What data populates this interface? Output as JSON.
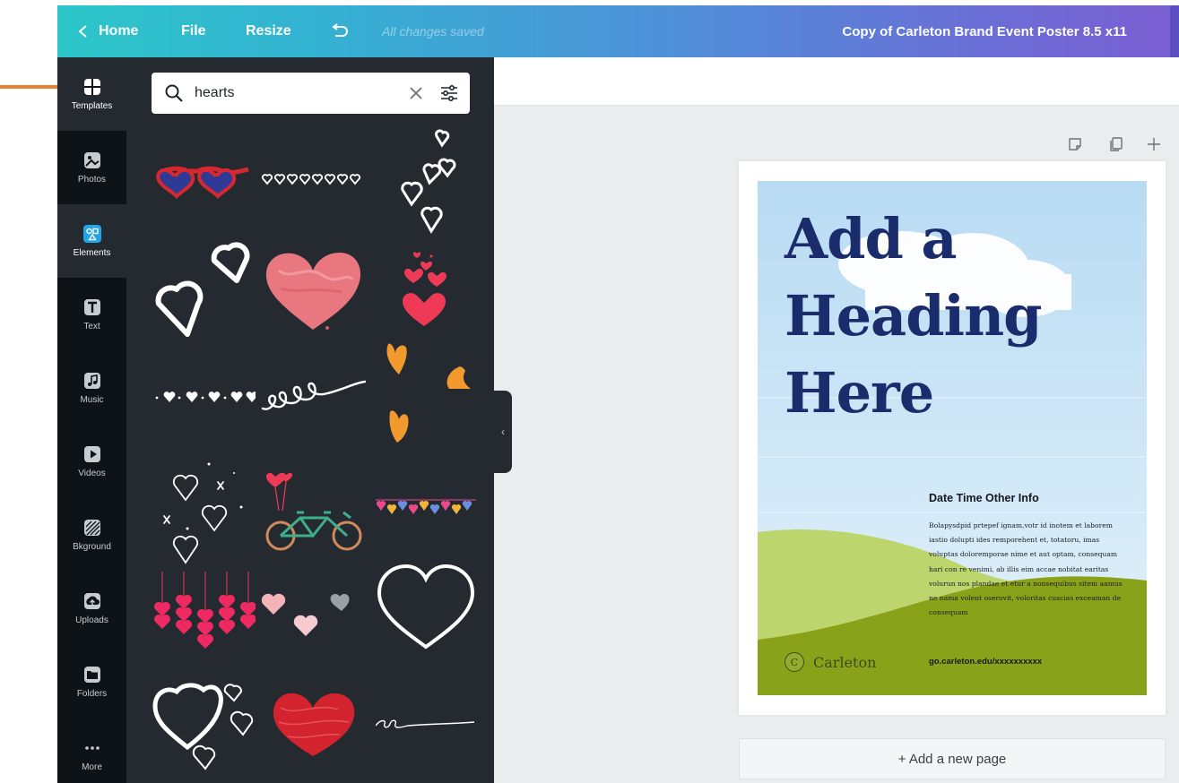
{
  "topbar": {
    "home_label": "Home",
    "file_label": "File",
    "resize_label": "Resize",
    "saved_status": "All changes saved",
    "document_title": "Copy of Carleton Brand Event Poster 8.5 x11",
    "gradient_start": "#2cc6c8",
    "gradient_end": "#7b5ed2"
  },
  "rail": {
    "items": [
      {
        "label": "Templates",
        "icon": "templates-icon"
      },
      {
        "label": "Photos",
        "icon": "photos-icon"
      },
      {
        "label": "Elements",
        "icon": "elements-icon",
        "active": true
      },
      {
        "label": "Text",
        "icon": "text-icon"
      },
      {
        "label": "Music",
        "icon": "music-icon"
      },
      {
        "label": "Videos",
        "icon": "videos-icon"
      },
      {
        "label": "Bkground",
        "icon": "background-icon"
      },
      {
        "label": "Uploads",
        "icon": "uploads-icon"
      },
      {
        "label": "Folders",
        "icon": "folders-icon"
      },
      {
        "label": "More",
        "icon": "more-icon"
      }
    ]
  },
  "search": {
    "value": "hearts"
  },
  "results": [
    "heart-sunglasses",
    "small-hearts-row",
    "scattered-outline-hearts",
    "double-outline-hearts",
    "painted-pink-heart",
    "falling-red-hearts",
    "dotted-hearts-line",
    "looped-hearts-line",
    "orange-hearts",
    "sketched-hearts-stars",
    "tandem-bike-hearts",
    "colorful-heart-bunting",
    "hanging-pink-hearts",
    "pastel-hearts-trio",
    "large-outline-heart",
    "brush-outline-hearts",
    "scribbled-red-heart",
    "thin-heart-line"
  ],
  "canvas": {
    "heading": "Add a\nHeading\nHere",
    "info_title": "Date Time Other Info",
    "info_body": "Bolapysdpid prtepef ignam,votr id inotem et laborem iastio dolupti ides remporehent et, totatoru, imas voluptas doloremporae nime et aut optam, consequam hari con re venimi, ab illis eim accae nobitat earitas volurun nos plandae et etur a nonsequibus sitem aamus ne nama volent oserovit, voloritas cuscias exceaman de consequam",
    "brand_name": "Carleton",
    "brand_seal": "C",
    "url": "go.carleton.edu/xxxxxxxxxx",
    "heading_color": "#1a2c6b",
    "field_color": "#8aa219"
  },
  "add_page_label": "+ Add a new page",
  "callout_color": "#e8822f"
}
